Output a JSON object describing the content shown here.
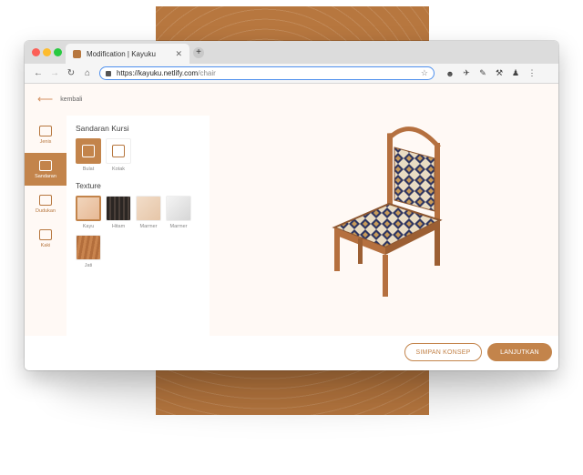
{
  "browser": {
    "tab_title": "Modification | Kayuku",
    "tab_close": "✕",
    "new_tab": "+",
    "url_host": "https://kayuku.netlify.com",
    "url_path": "/chair"
  },
  "page": {
    "back_label": "kembali",
    "sidebar": [
      {
        "label": "Jenis"
      },
      {
        "label": "Sandaran"
      },
      {
        "label": "Dudukan"
      },
      {
        "label": "Kaki"
      }
    ],
    "backrest_title": "Sandaran Kursi",
    "backrest_options": [
      {
        "label": "Bulat"
      },
      {
        "label": "Kotak"
      }
    ],
    "texture_title": "Texture",
    "texture_options": [
      {
        "label": "Kayu"
      },
      {
        "label": "Hitam"
      },
      {
        "label": "Marmer"
      },
      {
        "label": "Marmer"
      },
      {
        "label": "Jati"
      }
    ],
    "save_button": "SIMPAN KONSEP",
    "next_button": "LANJUTKAN"
  },
  "colors": {
    "brand": "#c3844b",
    "panel_bg": "#b7773f",
    "content_bg": "#fff9f5"
  }
}
